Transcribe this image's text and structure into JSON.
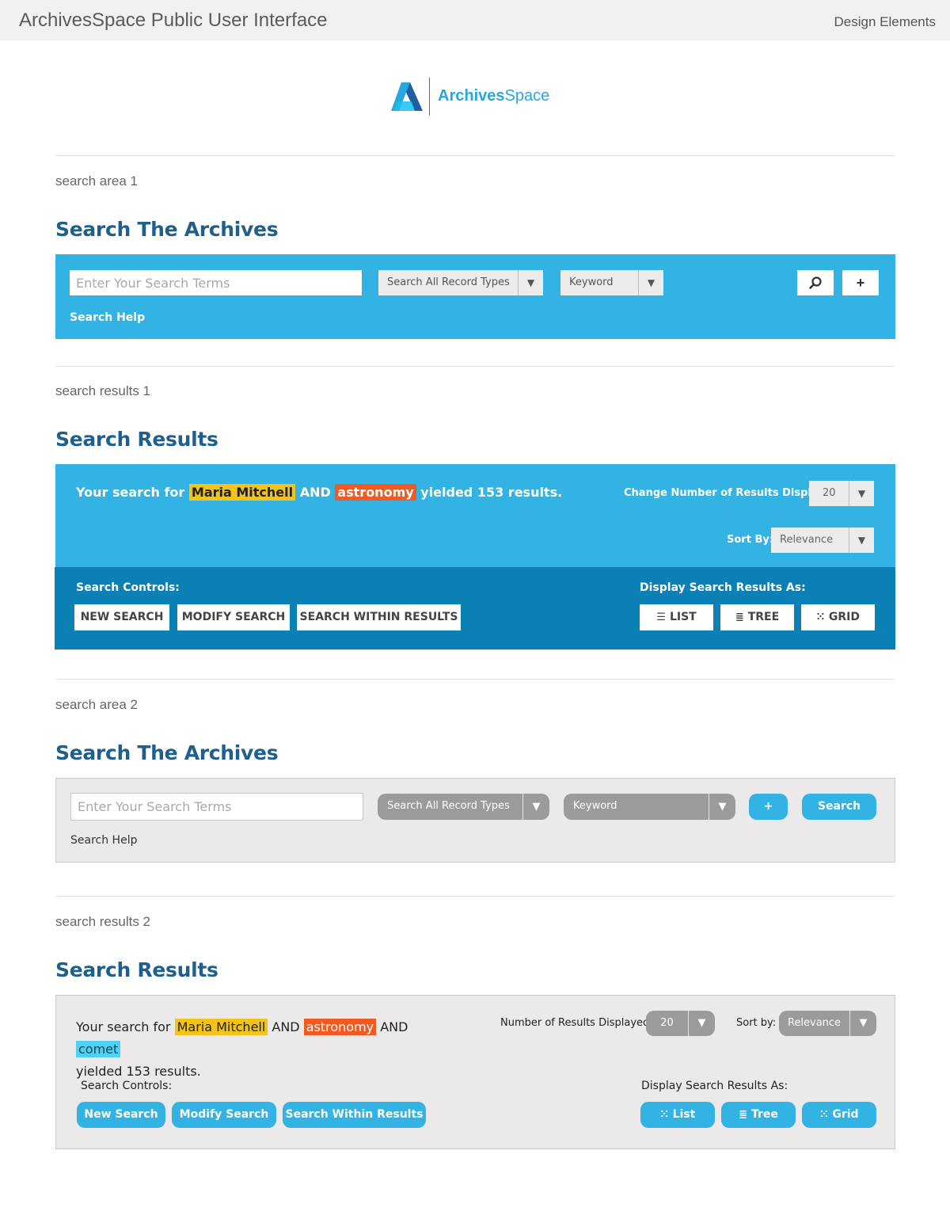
{
  "header": {
    "title": "ArchivesSpace Public User Interface",
    "design_link": "Design Elements"
  },
  "logo": {
    "text_bold": "Archives",
    "text_light": "Space",
    "icon": "archivesspace-a-logo"
  },
  "colors": {
    "accent": "#33b3e3",
    "accent_dark": "#0a80b4",
    "title_blue": "#1f5f8b",
    "highlight_yellow": "#f2c318",
    "highlight_orange": "#f15a22",
    "highlight_cyan": "#4fd2f2",
    "panel_gray": "#ebe9ea"
  },
  "search_area_1": {
    "section_label": "search area 1",
    "title": "Search The Archives",
    "input_placeholder": "Enter Your Search Terms",
    "record_type": "Search All Record Types",
    "field": "Keyword",
    "search_icon": "magnifier-icon",
    "add_label": "+",
    "help": "Search Help"
  },
  "search_results_1": {
    "section_label": "search results 1",
    "title": "Search Results",
    "summary_prefix": "Your search for",
    "term1": "Maria Mitchell",
    "op1": "AND",
    "term2": "astronomy",
    "summary_suffix": "yielded 153 results.",
    "change_number_label": "Change Number of Results Displayed:",
    "results_per_page": "20",
    "sort_label": "Sort By:",
    "sort_value": "Relevance",
    "controls_label": "Search Controls:",
    "new_search": "NEW SEARCH",
    "modify_search": "MODIFY SEARCH",
    "search_within": "SEARCH WITHIN RESULTS",
    "display_label": "Display Search Results As:",
    "list": "LIST",
    "tree": "TREE",
    "grid": "GRID"
  },
  "search_area_2": {
    "section_label": "search area 2",
    "title": "Search The Archives",
    "input_placeholder": "Enter Your Search Terms",
    "record_type": "Search All Record Types",
    "field": "Keyword",
    "add_label": "+",
    "search_button": "Search",
    "help": "Search Help"
  },
  "search_results_2": {
    "section_label": "search results 2",
    "title": "Search Results",
    "summary_prefix": "Your search for",
    "term1": "Maria Mitchell",
    "op1": "AND",
    "term2": "astronomy",
    "op2": "AND",
    "term3": "comet",
    "summary_suffix": "yielded 153 results.",
    "number_label": "Number of Results Displayed:",
    "results_per_page": "20",
    "sort_label": "Sort by:",
    "sort_value": "Relevance",
    "controls_label": "Search Controls:",
    "new_search": "New Search",
    "modify_search": "Modify Search",
    "search_within": "Search Within Results",
    "display_label": "Display Search Results As:",
    "list": "List",
    "tree": "Tree",
    "grid": "Grid"
  }
}
